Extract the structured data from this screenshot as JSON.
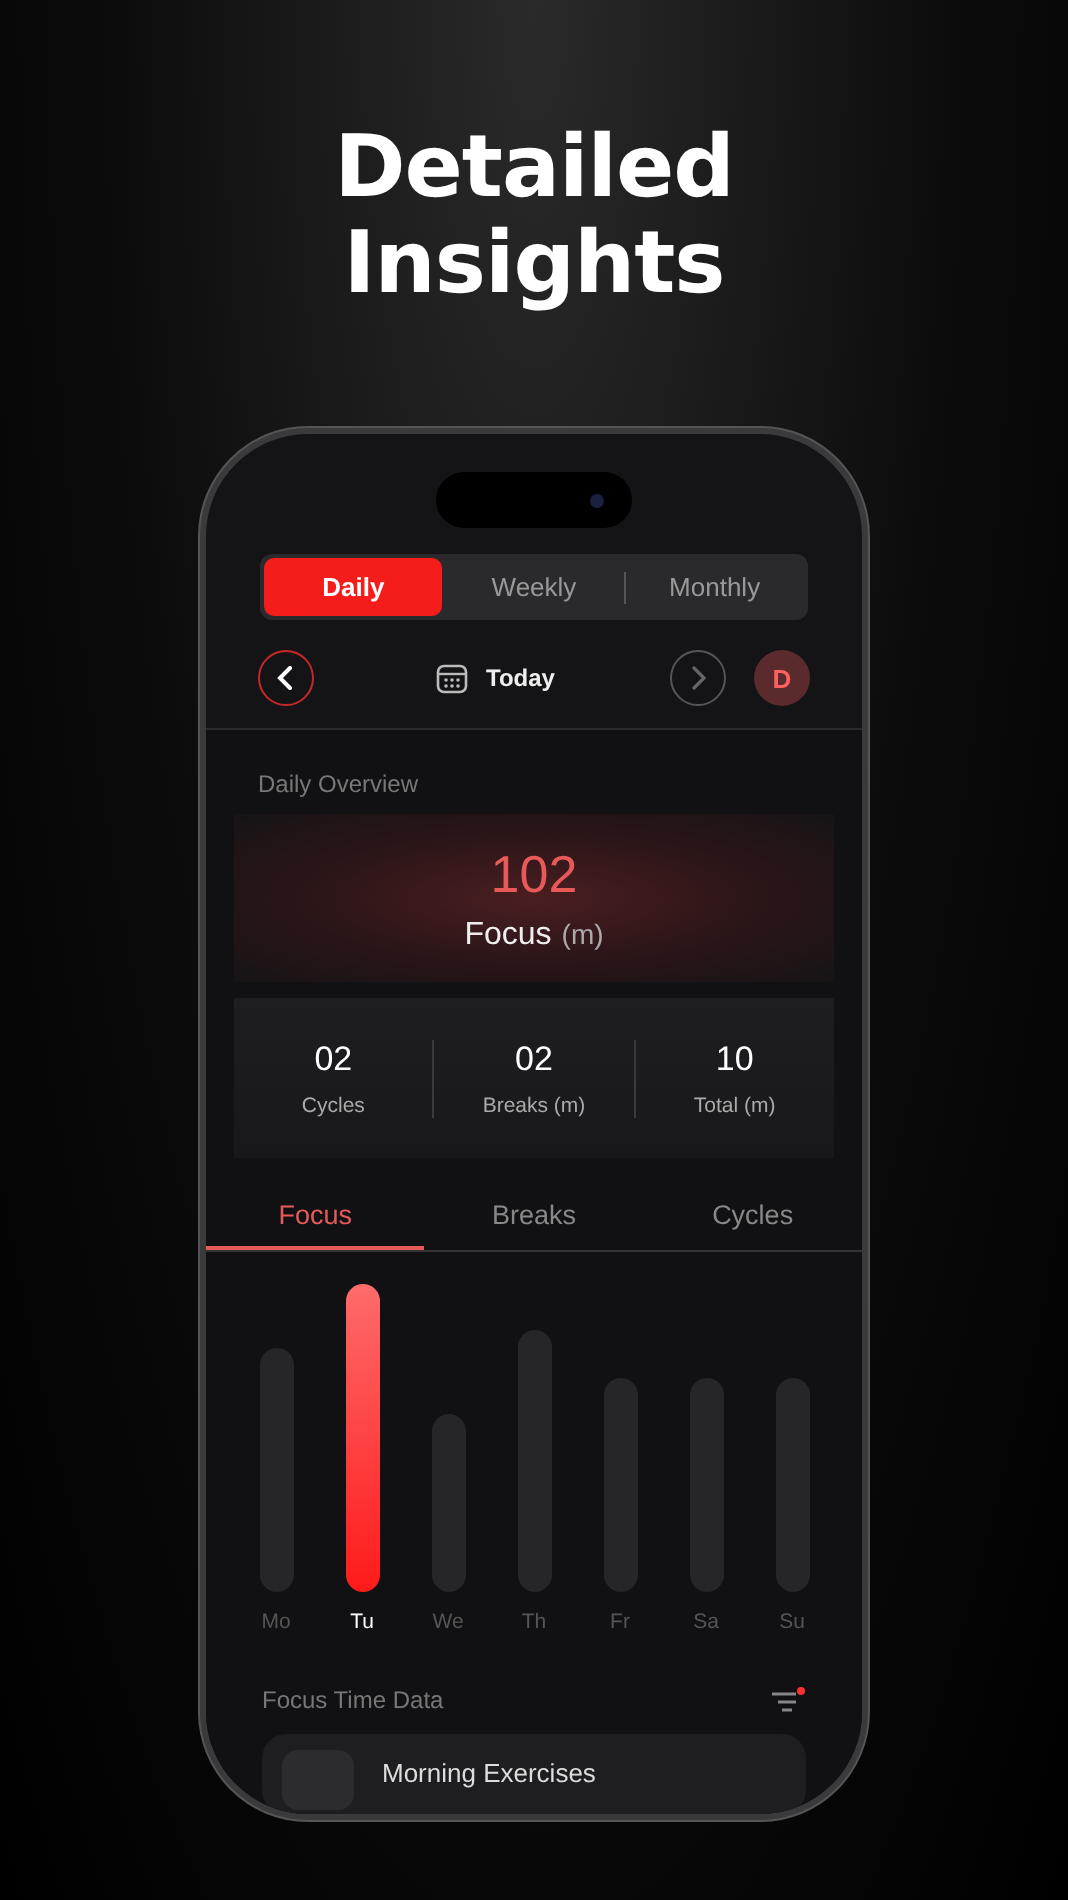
{
  "headline": "Detailed Insights",
  "period_tabs": [
    {
      "label": "Daily",
      "selected": true
    },
    {
      "label": "Weekly",
      "selected": false
    },
    {
      "label": "Monthly",
      "selected": false
    }
  ],
  "date_nav": {
    "label": "Today",
    "avatar": "D"
  },
  "overview": {
    "title": "Daily Overview",
    "focus_value": "102",
    "focus_label": "Focus",
    "focus_unit": "(m)",
    "stats": [
      {
        "value": "02",
        "label": "Cycles"
      },
      {
        "value": "02",
        "label": "Breaks (m)"
      },
      {
        "value": "10",
        "label": "Total (m)"
      }
    ]
  },
  "metric_tabs": [
    {
      "label": "Focus",
      "selected": true
    },
    {
      "label": "Breaks",
      "selected": false
    },
    {
      "label": "Cycles",
      "selected": false
    }
  ],
  "days": [
    {
      "label": "Mo",
      "selected": false
    },
    {
      "label": "Tu",
      "selected": true
    },
    {
      "label": "We",
      "selected": false
    },
    {
      "label": "Th",
      "selected": false
    },
    {
      "label": "Fr",
      "selected": false
    },
    {
      "label": "Sa",
      "selected": false
    },
    {
      "label": "Su",
      "selected": false
    }
  ],
  "data_section": {
    "title": "Focus Time Data",
    "filter_active": true,
    "items": [
      {
        "title": "Morning Exercises"
      }
    ]
  }
}
